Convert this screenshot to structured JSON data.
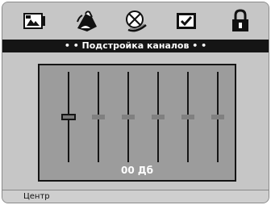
{
  "tabs": [
    {
      "icon": "picture-adjust-icon",
      "selected": false
    },
    {
      "icon": "speaker-hand-icon",
      "selected": false
    },
    {
      "icon": "satellite-dish-icon",
      "selected": false
    },
    {
      "icon": "checkbox-icon",
      "selected": false
    },
    {
      "icon": "lock-icon",
      "selected": false
    }
  ],
  "header": {
    "title": "• • Подстройка каналов • •"
  },
  "equalizer": {
    "value_label": "00 Дб",
    "sliders": [
      {
        "name": "slider-1",
        "selected": true,
        "level": 0.5
      },
      {
        "name": "slider-2",
        "selected": false,
        "level": 0.5
      },
      {
        "name": "slider-3",
        "selected": false,
        "level": 0.5
      },
      {
        "name": "slider-4",
        "selected": false,
        "level": 0.5
      },
      {
        "name": "slider-5",
        "selected": false,
        "level": 0.5
      },
      {
        "name": "slider-6",
        "selected": false,
        "level": 0.5
      }
    ]
  },
  "status": {
    "text": "Центр"
  },
  "colors": {
    "title_bar": "#151515",
    "frame": "#c6c6c6",
    "panel": "#9c9c9c"
  }
}
